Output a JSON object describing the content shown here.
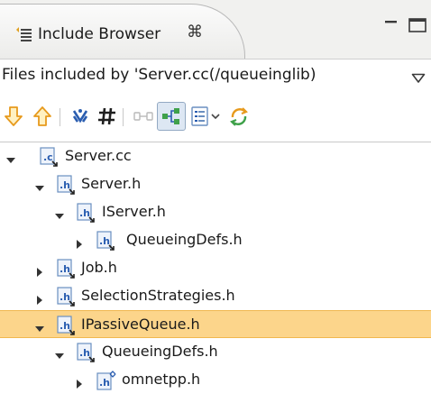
{
  "tab": {
    "title": "Include Browser",
    "close_glyph": "⌘",
    "icon": "include-browser-icon"
  },
  "window_controls": {
    "minimize_icon": "minimize-icon",
    "maximize_icon": "maximize-icon"
  },
  "header": {
    "text": "Files included by 'Server.cc(/queueinglib)",
    "menu_icon": "view-menu-icon"
  },
  "toolbar": {
    "buttons": [
      {
        "icon": "down-arrow-icon",
        "enabled": true
      },
      {
        "icon": "up-arrow-icon",
        "enabled": true
      },
      {
        "icon": "refresh-icon",
        "enabled": true
      },
      {
        "icon": "hash-icon",
        "enabled": true
      },
      {
        "icon": "link-icon",
        "enabled": false
      },
      {
        "icon": "hierarchy-toggle-icon",
        "enabled": true,
        "pressed": true
      },
      {
        "icon": "list-dropdown-icon",
        "enabled": true
      },
      {
        "icon": "sync-icon",
        "enabled": true
      }
    ]
  },
  "tree": {
    "items": [
      {
        "label": "Server.cc",
        "type": "c",
        "level": 0,
        "expanded": true,
        "selected": false
      },
      {
        "label": "Server.h",
        "type": "h",
        "level": 1,
        "expanded": true,
        "selected": false
      },
      {
        "label": "IServer.h",
        "type": "h",
        "level": 2,
        "expanded": true,
        "selected": false
      },
      {
        "label": "QueueingDefs.h",
        "type": "h",
        "level": 3,
        "expanded": false,
        "selected": false
      },
      {
        "label": "Job.h",
        "type": "h",
        "level": 1,
        "expanded": false,
        "selected": false
      },
      {
        "label": "SelectionStrategies.h",
        "type": "h",
        "level": 1,
        "expanded": false,
        "selected": false
      },
      {
        "label": "IPassiveQueue.h",
        "type": "h",
        "level": 1,
        "expanded": true,
        "selected": true
      },
      {
        "label": "QueueingDefs.h",
        "type": "h",
        "level": 2,
        "expanded": true,
        "selected": false
      },
      {
        "label": "omnetpp.h",
        "type": "h-external",
        "level": 3,
        "expanded": false,
        "selected": false
      }
    ]
  },
  "colors": {
    "selection": "#fcd58b",
    "icon_blue": "#2a5db0",
    "arrow_orange": "#e79a1d"
  }
}
